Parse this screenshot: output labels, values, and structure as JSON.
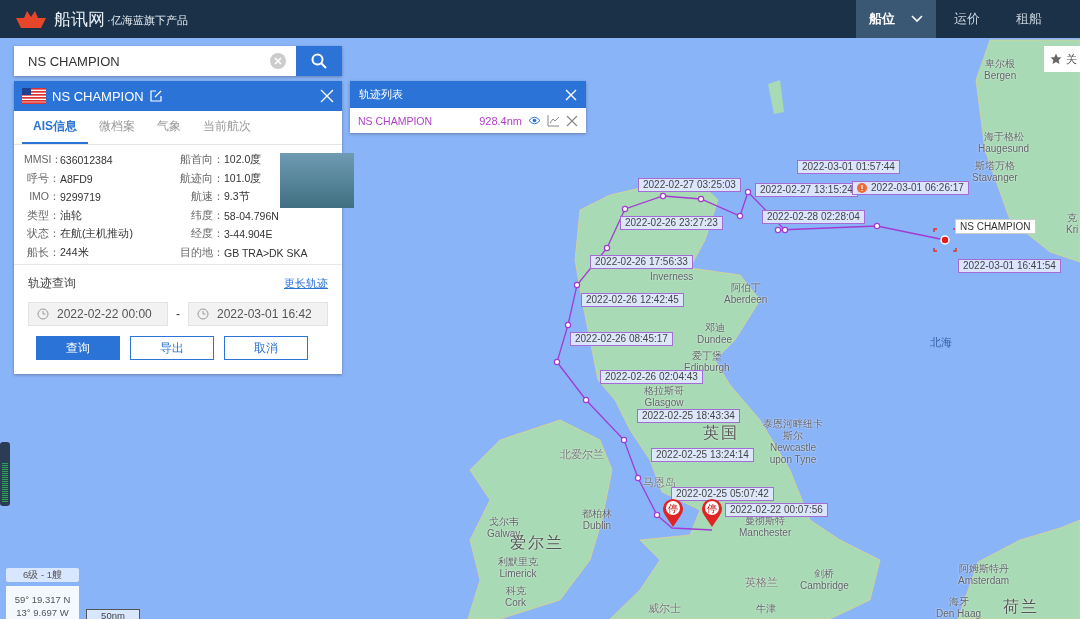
{
  "header": {
    "logo_text": "船讯网",
    "slogan": "·亿海蓝旗下产品",
    "nav": [
      {
        "label": "船位",
        "selected": true,
        "dropdown": true
      },
      {
        "label": "运价",
        "selected": false,
        "dropdown": false
      },
      {
        "label": "租船",
        "selected": false,
        "dropdown": false
      }
    ]
  },
  "search": {
    "value": "NS CHAMPION"
  },
  "ship_panel": {
    "name": "NS CHAMPION",
    "tabs": [
      {
        "label": "AIS信息",
        "selected": true
      },
      {
        "label": "微档案",
        "selected": false
      },
      {
        "label": "气象",
        "selected": false
      },
      {
        "label": "当前航次",
        "selected": false
      }
    ],
    "info_left": [
      {
        "label": "MMSI：",
        "value": "636012384"
      },
      {
        "label": "呼号：",
        "value": "A8FD9"
      },
      {
        "label": "IMO：",
        "value": "9299719"
      },
      {
        "label": "类型：",
        "value": "油轮"
      },
      {
        "label": "状态：",
        "value": "在航(主机推动)"
      },
      {
        "label": "船长：",
        "value": "244米"
      }
    ],
    "info_right": [
      {
        "label": "船首向：",
        "value": "102.0度"
      },
      {
        "label": "航迹向：",
        "value": "101.0度"
      },
      {
        "label": "航速：",
        "value": "9.3节"
      },
      {
        "label": "纬度：",
        "value": "58-04.796N"
      },
      {
        "label": "经度：",
        "value": "3-44.904E"
      },
      {
        "label": "目的地：",
        "value": "GB TRA>DK SKA"
      }
    ],
    "track_query": {
      "title": "轨迹查询",
      "link": "更长轨迹",
      "start": "2022-02-22 00:00",
      "separator": "-",
      "end": "2022-03-01 16:42",
      "buttons": [
        {
          "label": "查询",
          "kind": "primary"
        },
        {
          "label": "导出",
          "kind": "secondary"
        },
        {
          "label": "取消",
          "kind": "secondary"
        }
      ]
    }
  },
  "track_list": {
    "title": "轨迹列表",
    "rows": [
      {
        "name": "NS CHAMPION",
        "distance": "928.4nm"
      }
    ]
  },
  "map": {
    "side_button": "关",
    "ship_label": "NS CHAMPION",
    "stop_markers": [
      "停",
      "停"
    ],
    "track_labels": [
      {
        "text": "2022-03-01 01:57:44",
        "kind": "plain"
      },
      {
        "text": "2022-02-27 03:25:03",
        "kind": "plain"
      },
      {
        "text": "2022-02-27 13:15:24",
        "kind": "plain"
      },
      {
        "text": "2022-03-01 06:26:17",
        "kind": "alert"
      },
      {
        "text": "2022-02-28 02:28:04",
        "kind": "plain"
      },
      {
        "text": "2022-02-26 23:27:23",
        "kind": "plain"
      },
      {
        "text": "2022-03-01 16:41:54",
        "kind": "plain"
      },
      {
        "text": "2022-02-26 17:56:33",
        "kind": "plain"
      },
      {
        "text": "2022-02-26 12:42:45",
        "kind": "plain"
      },
      {
        "text": "2022-02-26 08:45:17",
        "kind": "plain"
      },
      {
        "text": "2022-02-26 02:04:43",
        "kind": "plain"
      },
      {
        "text": "2022-02-25 18:43:34",
        "kind": "plain"
      },
      {
        "text": "2022-02-25 13:24:14",
        "kind": "plain"
      },
      {
        "text": "2022-02-25 05:07:42",
        "kind": "plain"
      },
      {
        "text": "2022-02-22 00:07:56",
        "kind": "plain"
      }
    ],
    "places": [
      {
        "kind": "city",
        "zh": "卑尔根",
        "en": "Bergen"
      },
      {
        "kind": "city",
        "zh": "海于格松",
        "en": "Haugesund"
      },
      {
        "kind": "city",
        "zh": "斯塔万格",
        "en": "Stavanger"
      },
      {
        "kind": "city",
        "zh": "克",
        "en": "Kri"
      },
      {
        "kind": "city",
        "en": "Inverness"
      },
      {
        "kind": "city",
        "zh": "阿伯丁",
        "en": "Aberdeen"
      },
      {
        "kind": "city",
        "zh": "邓迪",
        "en": "Dundee"
      },
      {
        "kind": "city",
        "zh": "爱丁堡",
        "en": "Edinburgh"
      },
      {
        "kind": "city",
        "zh": "格拉斯哥",
        "en": "Glasgow"
      },
      {
        "kind": "country",
        "zh": "英国"
      },
      {
        "kind": "city",
        "zh": "泰恩河畔纽卡斯尔",
        "en": "Newcastle upon Tyne"
      },
      {
        "kind": "region",
        "zh": "北爱尔兰"
      },
      {
        "kind": "region",
        "zh": "马恩岛"
      },
      {
        "kind": "city",
        "zh": "曼彻斯特",
        "en": "Manchester"
      },
      {
        "kind": "city",
        "zh": "都柏林",
        "en": "Dublin"
      },
      {
        "kind": "city",
        "zh": "戈尔韦",
        "en": "Galway"
      },
      {
        "kind": "country",
        "zh": "爱尔兰"
      },
      {
        "kind": "city",
        "zh": "利默里克",
        "en": "Limerick"
      },
      {
        "kind": "city",
        "zh": "科克",
        "en": "Cork"
      },
      {
        "kind": "region",
        "zh": "威尔士"
      },
      {
        "kind": "region",
        "zh": "英格兰"
      },
      {
        "kind": "city",
        "zh": "剑桥",
        "en": "Cambridge"
      },
      {
        "kind": "city",
        "zh": "牛津"
      },
      {
        "kind": "city",
        "zh": "阿姆斯特丹",
        "en": "Amsterdam"
      },
      {
        "kind": "city",
        "zh": "海牙",
        "en": "Den Haag"
      },
      {
        "kind": "country",
        "zh": "荷兰"
      },
      {
        "kind": "sea",
        "zh": "北海"
      }
    ],
    "zoom_slider": {
      "level": 0.7
    },
    "zoom_info": "6级 - 1艘",
    "coords": [
      "59° 19.317 N",
      "13° 9.697 W"
    ],
    "scale": "50nm"
  }
}
